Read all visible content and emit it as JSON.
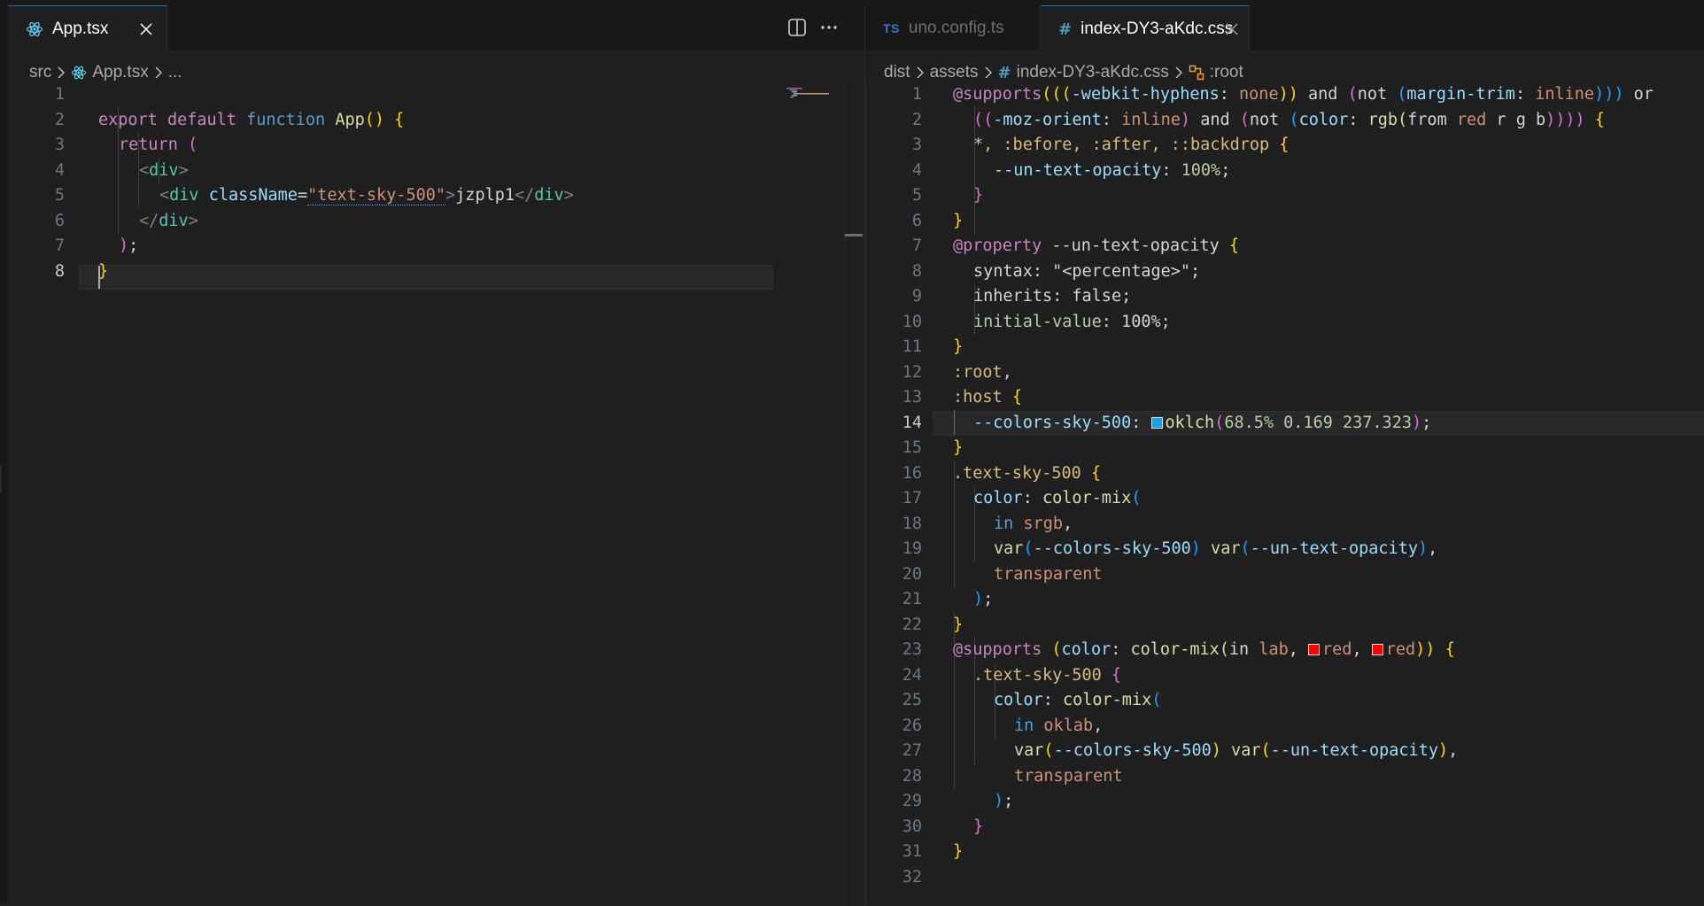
{
  "left": {
    "tab": {
      "label": "App.tsx",
      "icon": "react-icon"
    },
    "actions": [
      "split-editor-icon",
      "more-actions-icon"
    ],
    "breadcrumb": {
      "folder": "src",
      "file": "App.tsx",
      "ellipsis": "..."
    },
    "lines": [
      {
        "n": "1"
      },
      {
        "n": "2"
      },
      {
        "n": "3"
      },
      {
        "n": "4"
      },
      {
        "n": "5"
      },
      {
        "n": "6"
      },
      {
        "n": "7"
      },
      {
        "n": "8"
      }
    ],
    "code": {
      "l1": [
        "export",
        "default",
        "function",
        "App",
        "()",
        "{"
      ],
      "l2": [
        "return",
        "("
      ],
      "l3": [
        "<",
        "div",
        ">"
      ],
      "l4": [
        "<",
        "div",
        "className",
        "=",
        "\"text-sky-500\"",
        ">",
        "jzplp1",
        "</",
        "div",
        ">"
      ],
      "l5": [
        "</",
        "div",
        ">"
      ],
      "l6": [
        ")",
        ";"
      ],
      "l7": [
        "}"
      ]
    }
  },
  "right": {
    "tabs": [
      {
        "label": "uno.config.ts",
        "badge": "TS",
        "active": false
      },
      {
        "label": "index-DY3-aKdc.css",
        "badge": "#",
        "active": true
      }
    ],
    "breadcrumb": {
      "d1": "dist",
      "d2": "assets",
      "file": "index-DY3-aKdc.css",
      "symbol": ":root"
    },
    "code": {
      "l1": [
        "@supports",
        "(((",
        "-webkit-hyphens",
        ":",
        " none",
        "))",
        " and ",
        "(",
        "not ",
        "(",
        "margin-trim",
        ":",
        " inline",
        ")))",
        " or"
      ],
      "l2": [
        "((",
        "-moz-orient",
        ":",
        " inline",
        ")",
        " and ",
        "(",
        "not ",
        "(",
        "color",
        ":",
        " rgb(",
        "from ",
        "red",
        " r g b",
        "))))",
        " {"
      ],
      "l3": [
        "*",
        ", :before, :after, ::backdrop",
        " {"
      ],
      "l4": [
        "--un-text-opacity",
        ":",
        " 100%",
        ";"
      ],
      "l5": [
        "}"
      ],
      "l6": [
        "}"
      ],
      "l7": [
        "@property",
        " --un-text-opacity",
        " {"
      ],
      "l8": [
        "syntax",
        ":",
        " \"<percentage>\"",
        ";"
      ],
      "l9": [
        "inherits",
        ":",
        " false",
        ";"
      ],
      "l10": [
        "initial-value",
        ":",
        " 100%",
        ";"
      ],
      "l11": [
        "}"
      ],
      "l12": [
        ":root",
        ","
      ],
      "l13": [
        ":host",
        " {"
      ],
      "l14": [
        "--colors-sky-500",
        ":",
        "oklch",
        "(",
        "68.5% 0.169 237.323",
        ")",
        ";"
      ],
      "l15": [
        "}"
      ],
      "l16": [
        ".text-sky-500",
        " {"
      ],
      "l17": [
        "color",
        ":",
        " color-mix",
        "("
      ],
      "l18": [
        "in ",
        "srgb",
        ","
      ],
      "l19": [
        "var",
        "(",
        "--colors-sky-500",
        ")",
        " var",
        "(",
        "--un-text-opacity",
        ")",
        ","
      ],
      "l20": [
        "transparent"
      ],
      "l21": [
        ")",
        ";"
      ],
      "l22": [
        "}"
      ],
      "l23": [
        "@supports",
        " (",
        "color",
        ":",
        " color-mix(",
        "in ",
        "lab",
        ", ",
        "red",
        ", ",
        "red",
        "))",
        " {"
      ],
      "l24": [
        ".text-sky-500",
        " {"
      ],
      "l25": [
        "color",
        ":",
        " color-mix",
        "("
      ],
      "l26": [
        "in ",
        "oklab",
        ","
      ],
      "l27": [
        "var",
        "(",
        "--colors-sky-500",
        ")",
        " var",
        "(",
        "--un-text-opacity",
        ")",
        ","
      ],
      "l28": [
        "transparent"
      ],
      "l29": [
        ")",
        ";"
      ],
      "l30": [
        "}"
      ],
      "l31": [
        "}"
      ],
      "l32": []
    },
    "colors": {
      "sky": "#0ea5e9",
      "red": "#ff0000"
    }
  }
}
